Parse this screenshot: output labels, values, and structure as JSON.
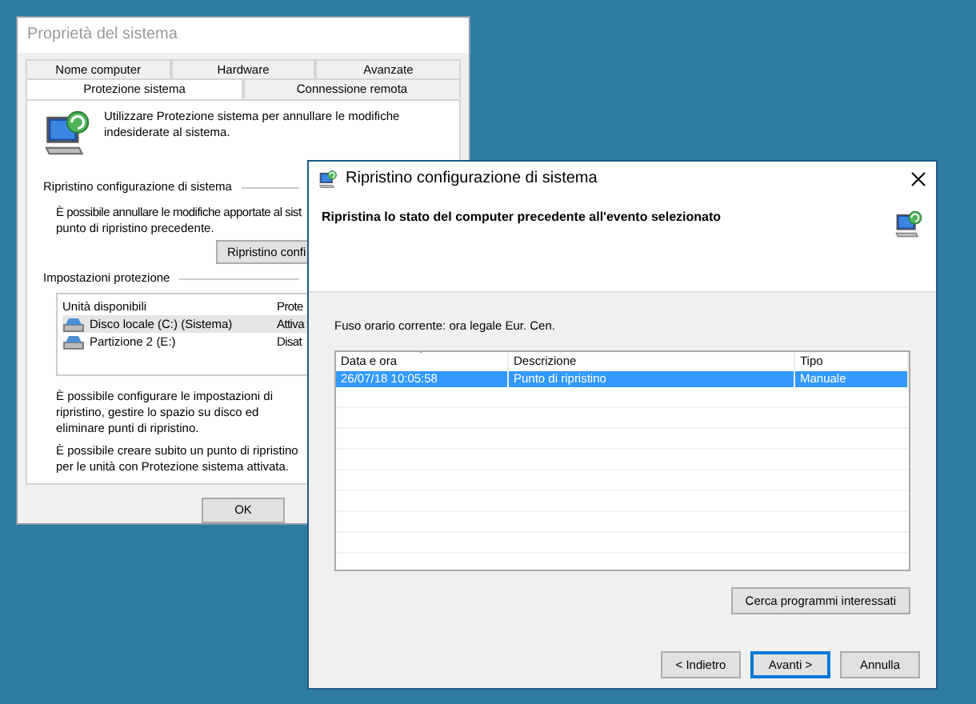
{
  "back_window": {
    "title": "Proprietà del sistema",
    "tab_rows": [
      {
        "tabs": [
          {
            "label": "Nome computer",
            "selected": false
          },
          {
            "label": "Hardware",
            "selected": false
          },
          {
            "label": "Avanzate",
            "selected": false
          }
        ]
      },
      {
        "tabs": [
          {
            "label": "Protezione sistema",
            "selected": true
          },
          {
            "label": "Connessione remota",
            "selected": false
          }
        ]
      }
    ],
    "intro": "Utilizzare Protezione sistema per annullare le modifiche indesiderate al sistema.",
    "restore": {
      "heading": "Ripristino configurazione di sistema",
      "text": "È possibile annullare le modifiche apportate al sist",
      "text_2": "punto di ripristino precedente.",
      "button": "Ripristino confi"
    },
    "protection": {
      "heading": "Impostazioni protezione",
      "columns": [
        "Unità disponibili",
        "Prote"
      ],
      "drives": [
        {
          "name": "Disco locale (C:) (Sistema)",
          "status": "Attiva",
          "selected": true
        },
        {
          "name": "Partizione 2 (E:)",
          "status": "Disat",
          "selected": false
        }
      ]
    },
    "notes": [
      "È possibile configurare le impostazioni di ripristino, gestire lo spazio su disco ed eliminare punti di ripristino.",
      "È possibile creare subito un punto di ripristino per le unità con Protezione sistema attivata."
    ],
    "buttons": [
      "OK"
    ]
  },
  "front_window": {
    "title": "Ripristino configurazione di sistema",
    "heading": "Ripristina lo stato del computer precedente all'evento selezionato",
    "timezone": "Fuso orario corrente: ora legale Eur. Cen.",
    "table": {
      "columns": [
        "Data e ora",
        "Descrizione",
        "Tipo"
      ],
      "rows": [
        {
          "cells": [
            "26/07/18 10:05:58",
            "Punto di ripristino",
            "Manuale"
          ],
          "selected": true
        }
      ]
    },
    "search_button": "Cerca programmi interessati",
    "buttons": [
      {
        "label": "< Indietro",
        "selected": false
      },
      {
        "label": "Avanti >",
        "selected": true
      },
      {
        "label": "Annulla",
        "selected": false
      }
    ]
  }
}
